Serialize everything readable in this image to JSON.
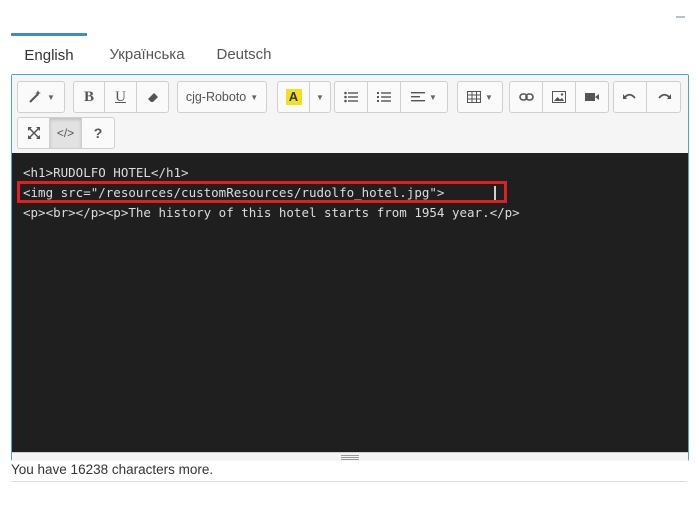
{
  "tabs": [
    {
      "label": "English",
      "active": true
    },
    {
      "label": "Українська",
      "active": false
    },
    {
      "label": "Deutsch",
      "active": false
    }
  ],
  "toolbar": {
    "style_icon": "magic-wand-icon",
    "bold_label": "B",
    "underline_label": "U",
    "font_name": "cjg-Roboto",
    "help_label": "?",
    "codeview_label": "</>"
  },
  "code": {
    "line1": "<h1>RUDOLFO HOTEL</h1>",
    "line2": "<img src=\"/resources/customResources/rudolfo_hotel.jpg\">",
    "line3": "<p><br></p><p>The history of this hotel starts from 1954 year.</p>"
  },
  "footer": {
    "counter_text": "You have 16238 characters more."
  },
  "colors": {
    "accent": "#3b8ec3",
    "highlight": "#e02020",
    "code_bg": "#1f1f1f",
    "marker": "#f0e020"
  }
}
